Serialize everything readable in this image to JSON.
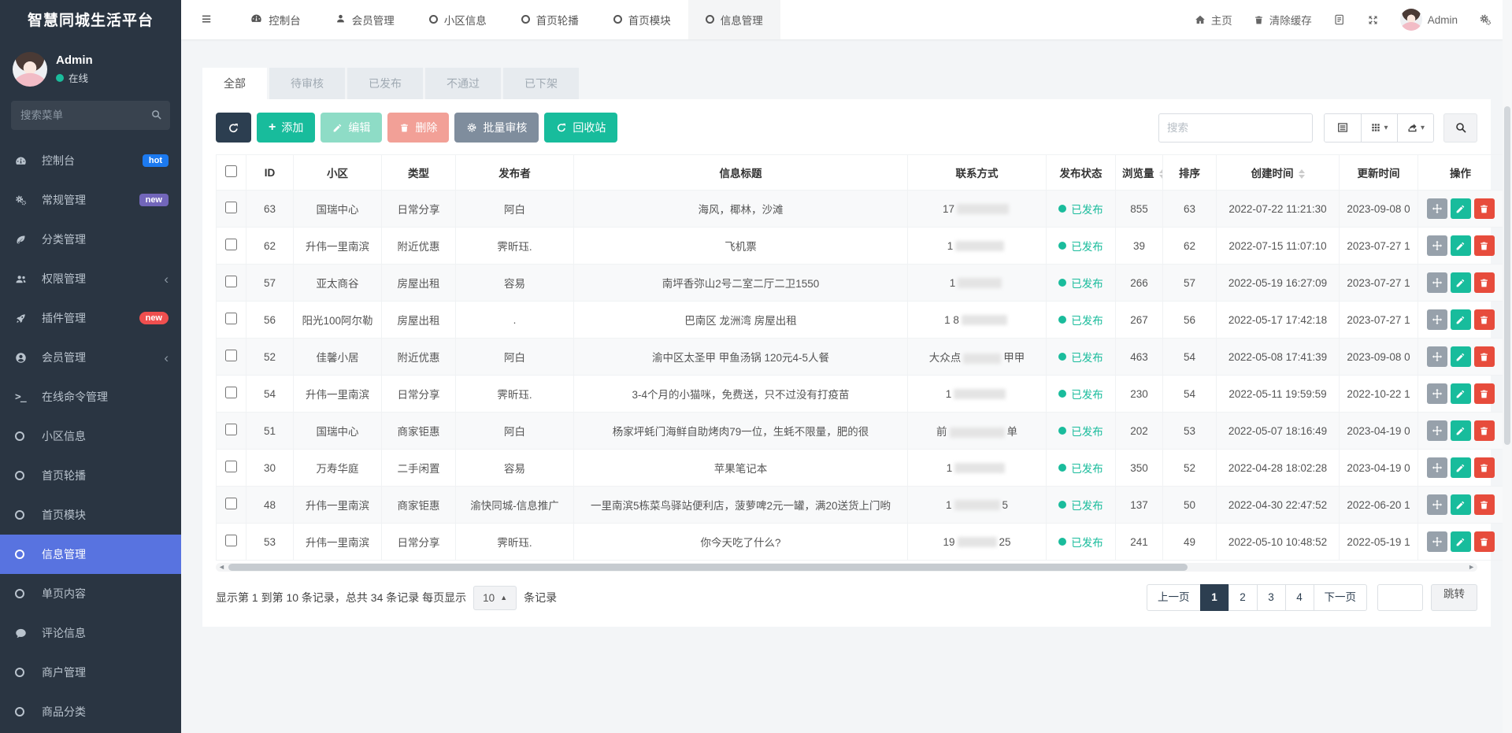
{
  "app": {
    "logo": "智慧同城生活平台"
  },
  "topnav": {
    "items": [
      {
        "icon": "dashboard",
        "label": "控制台",
        "active": false
      },
      {
        "icon": "user",
        "label": "会员管理",
        "active": false
      },
      {
        "icon": "circle",
        "label": "小区信息",
        "active": false
      },
      {
        "icon": "circle",
        "label": "首页轮播",
        "active": false
      },
      {
        "icon": "circle",
        "label": "首页模块",
        "active": false
      },
      {
        "icon": "circle",
        "label": "信息管理",
        "active": true
      }
    ],
    "right": {
      "home": "主页",
      "clear_cache": "清除缓存",
      "username": "Admin"
    }
  },
  "sidebar": {
    "user": {
      "name": "Admin",
      "status": "在线"
    },
    "search_placeholder": "搜索菜单",
    "items": [
      {
        "icon": "dashboard",
        "label": "控制台",
        "badge": "hot",
        "badge_color": "#1c7af0"
      },
      {
        "icon": "gears",
        "label": "常规管理",
        "badge": "new",
        "badge_color": "#7266ba"
      },
      {
        "icon": "leaf",
        "label": "分类管理"
      },
      {
        "icon": "users",
        "label": "权限管理",
        "arrow": true
      },
      {
        "icon": "rocket",
        "label": "插件管理",
        "badge": "new",
        "badge_color": "#ef4f4f",
        "badge_pill": true
      },
      {
        "icon": "user-circle",
        "label": "会员管理",
        "arrow": true
      },
      {
        "icon": "terminal",
        "label": "在线命令管理"
      },
      {
        "icon": "circle",
        "label": "小区信息"
      },
      {
        "icon": "circle",
        "label": "首页轮播"
      },
      {
        "icon": "circle",
        "label": "首页模块"
      },
      {
        "icon": "circle",
        "label": "信息管理",
        "active": true
      },
      {
        "icon": "circle",
        "label": "单页内容"
      },
      {
        "icon": "comment",
        "label": "评论信息"
      },
      {
        "icon": "circle",
        "label": "商户管理"
      },
      {
        "icon": "circle",
        "label": "商品分类"
      }
    ]
  },
  "tabs": [
    {
      "label": "全部",
      "active": true
    },
    {
      "label": "待审核",
      "active": false
    },
    {
      "label": "已发布",
      "active": false
    },
    {
      "label": "不通过",
      "active": false
    },
    {
      "label": "已下架",
      "active": false
    }
  ],
  "toolbar": {
    "add": "添加",
    "edit": "编辑",
    "del": "删除",
    "batch": "批量审核",
    "recycle": "回收站",
    "search_placeholder": "搜索"
  },
  "table": {
    "columns": [
      "ID",
      "小区",
      "类型",
      "发布者",
      "信息标题",
      "联系方式",
      "发布状态",
      "浏览量",
      "排序",
      "创建时间",
      "更新时间",
      "操作"
    ],
    "rows": [
      {
        "id": "63",
        "community": "国瑞中心",
        "type": "日常分享",
        "publisher": "阿白",
        "title": "海风，椰林，沙滩",
        "contact_pre": "17",
        "contact_post": "",
        "blur": 66,
        "status": "已发布",
        "views": "855",
        "sort": "63",
        "created": "2022-07-22 11:21:30",
        "updated": "2023-09-08 0"
      },
      {
        "id": "62",
        "community": "升伟一里南滨",
        "type": "附近优惠",
        "publisher": "霁昕珏.",
        "title": "飞机票",
        "contact_pre": "1",
        "contact_post": "",
        "blur": 62,
        "status": "已发布",
        "views": "39",
        "sort": "62",
        "created": "2022-07-15 11:07:10",
        "updated": "2023-07-27 1"
      },
      {
        "id": "57",
        "community": "亚太商谷",
        "type": "房屋出租",
        "publisher": "容易",
        "title": "南坪香弥山2号二室二厅二卫1550",
        "contact_pre": "1",
        "contact_post": "",
        "blur": 56,
        "status": "已发布",
        "views": "266",
        "sort": "57",
        "created": "2022-05-19 16:27:09",
        "updated": "2023-07-27 1"
      },
      {
        "id": "56",
        "community": "阳光100阿尔勒",
        "type": "房屋出租",
        "publisher": ".",
        "title": "巴南区 龙洲湾 房屋出租",
        "contact_pre": "1 8",
        "contact_post": "",
        "blur": 58,
        "status": "已发布",
        "views": "267",
        "sort": "56",
        "created": "2022-05-17 17:42:18",
        "updated": "2023-07-27 1"
      },
      {
        "id": "52",
        "community": "佳馨小居",
        "type": "附近优惠",
        "publisher": "阿白",
        "title": "渝中区太圣甲 甲鱼汤锅 120元4-5人餐",
        "contact_pre": "大众点",
        "contact_post": "甲甲",
        "blur": 48,
        "status": "已发布",
        "views": "463",
        "sort": "54",
        "created": "2022-05-08 17:41:39",
        "updated": "2023-09-08 0"
      },
      {
        "id": "54",
        "community": "升伟一里南滨",
        "type": "日常分享",
        "publisher": "霁昕珏.",
        "title": "3-4个月的小猫咪，免费送，只不过没有打疫苗",
        "contact_pre": "1",
        "contact_post": "",
        "blur": 66,
        "status": "已发布",
        "views": "230",
        "sort": "54",
        "created": "2022-05-11 19:59:59",
        "updated": "2022-10-22 1"
      },
      {
        "id": "51",
        "community": "国瑞中心",
        "type": "商家钜惠",
        "publisher": "阿白",
        "title": "杨家坪蚝门海鲜自助烤肉79一位，生蚝不限量，肥的很",
        "contact_pre": "前",
        "contact_post": "单",
        "blur": 70,
        "status": "已发布",
        "views": "202",
        "sort": "53",
        "created": "2022-05-07 18:16:49",
        "updated": "2023-04-19 0"
      },
      {
        "id": "30",
        "community": "万寿华庭",
        "type": "二手闲置",
        "publisher": "容易",
        "title": "苹果笔记本",
        "contact_pre": "1",
        "contact_post": "",
        "blur": 64,
        "status": "已发布",
        "views": "350",
        "sort": "52",
        "created": "2022-04-28 18:02:28",
        "updated": "2023-04-19 0"
      },
      {
        "id": "48",
        "community": "升伟一里南滨",
        "type": "商家钜惠",
        "publisher": "渝快同城-信息推广",
        "title": "一里南滨5栋菜鸟驿站便利店，菠萝啤2元一罐，满20送货上门哟",
        "contact_pre": "1",
        "contact_post": "5",
        "blur": 58,
        "status": "已发布",
        "views": "137",
        "sort": "50",
        "created": "2022-04-30 22:47:52",
        "updated": "2022-06-20 1"
      },
      {
        "id": "53",
        "community": "升伟一里南滨",
        "type": "日常分享",
        "publisher": "霁昕珏.",
        "title": "你今天吃了什么?",
        "contact_pre": "19",
        "contact_post": "25",
        "blur": 50,
        "status": "已发布",
        "views": "241",
        "sort": "49",
        "created": "2022-05-10 10:48:52",
        "updated": "2022-05-19 1"
      }
    ]
  },
  "pagination": {
    "info_pre": "显示第 1 到第 10 条记录，总共 34 条记录 每页显示",
    "page_size": "10",
    "info_post": "条记录",
    "prev": "上一页",
    "next": "下一页",
    "pages": [
      "1",
      "2",
      "3",
      "4"
    ],
    "active": "1",
    "jump": "跳转"
  },
  "colors": {
    "accent_green": "#18bc9c",
    "accent_dark": "#2c3e50",
    "active_blue": "#5873e0",
    "danger_red": "#e74c3c",
    "sidebar_bg": "#2a3542",
    "status_green": "#1abc9c"
  }
}
